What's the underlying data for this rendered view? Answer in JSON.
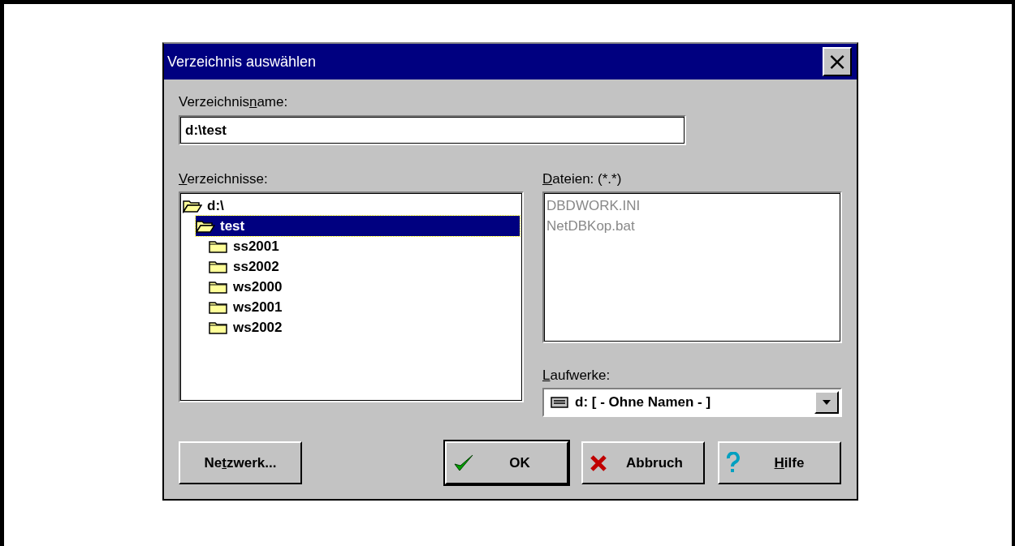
{
  "window": {
    "title": "Verzeichnis auswählen",
    "close": "×"
  },
  "name_label": {
    "pre": "Verzeichnis",
    "key": "n",
    "post": "ame:"
  },
  "name_field": {
    "value": "d:\\test"
  },
  "dirs_label": {
    "key": "V",
    "post": "erzeichnisse:"
  },
  "tree": [
    {
      "label": "d:\\",
      "expanded": true,
      "selected": false,
      "children": [
        {
          "label": "test",
          "expanded": true,
          "selected": true,
          "children": [
            {
              "label": "ss2001",
              "expanded": false,
              "selected": false
            },
            {
              "label": "ss2002",
              "expanded": false,
              "selected": false
            },
            {
              "label": "ws2000",
              "expanded": false,
              "selected": false
            },
            {
              "label": "ws2001",
              "expanded": false,
              "selected": false
            },
            {
              "label": "ws2002",
              "expanded": false,
              "selected": false
            }
          ]
        }
      ]
    }
  ],
  "files_label": {
    "key": "D",
    "post": "ateien: (*.*)"
  },
  "files": [
    {
      "name": "DBDWORK.INI",
      "disabled": true
    },
    {
      "name": "NetDBKop.bat",
      "disabled": true
    }
  ],
  "drives_label": {
    "key": "L",
    "post": "aufwerke:"
  },
  "drive": {
    "value": "d: [ - Ohne Namen - ]"
  },
  "buttons": [
    {
      "kind": "plain",
      "label": {
        "pre": "Ne",
        "key": "t",
        "post": "zwerk..."
      },
      "default": false
    },
    {
      "kind": "ok",
      "label": {
        "pre": "OK"
      },
      "default": true
    },
    {
      "kind": "cancel",
      "label": {
        "pre": "Abbruch"
      },
      "default": false
    },
    {
      "kind": "help",
      "label": {
        "key": "H",
        "post": "ilfe"
      },
      "default": false
    }
  ]
}
